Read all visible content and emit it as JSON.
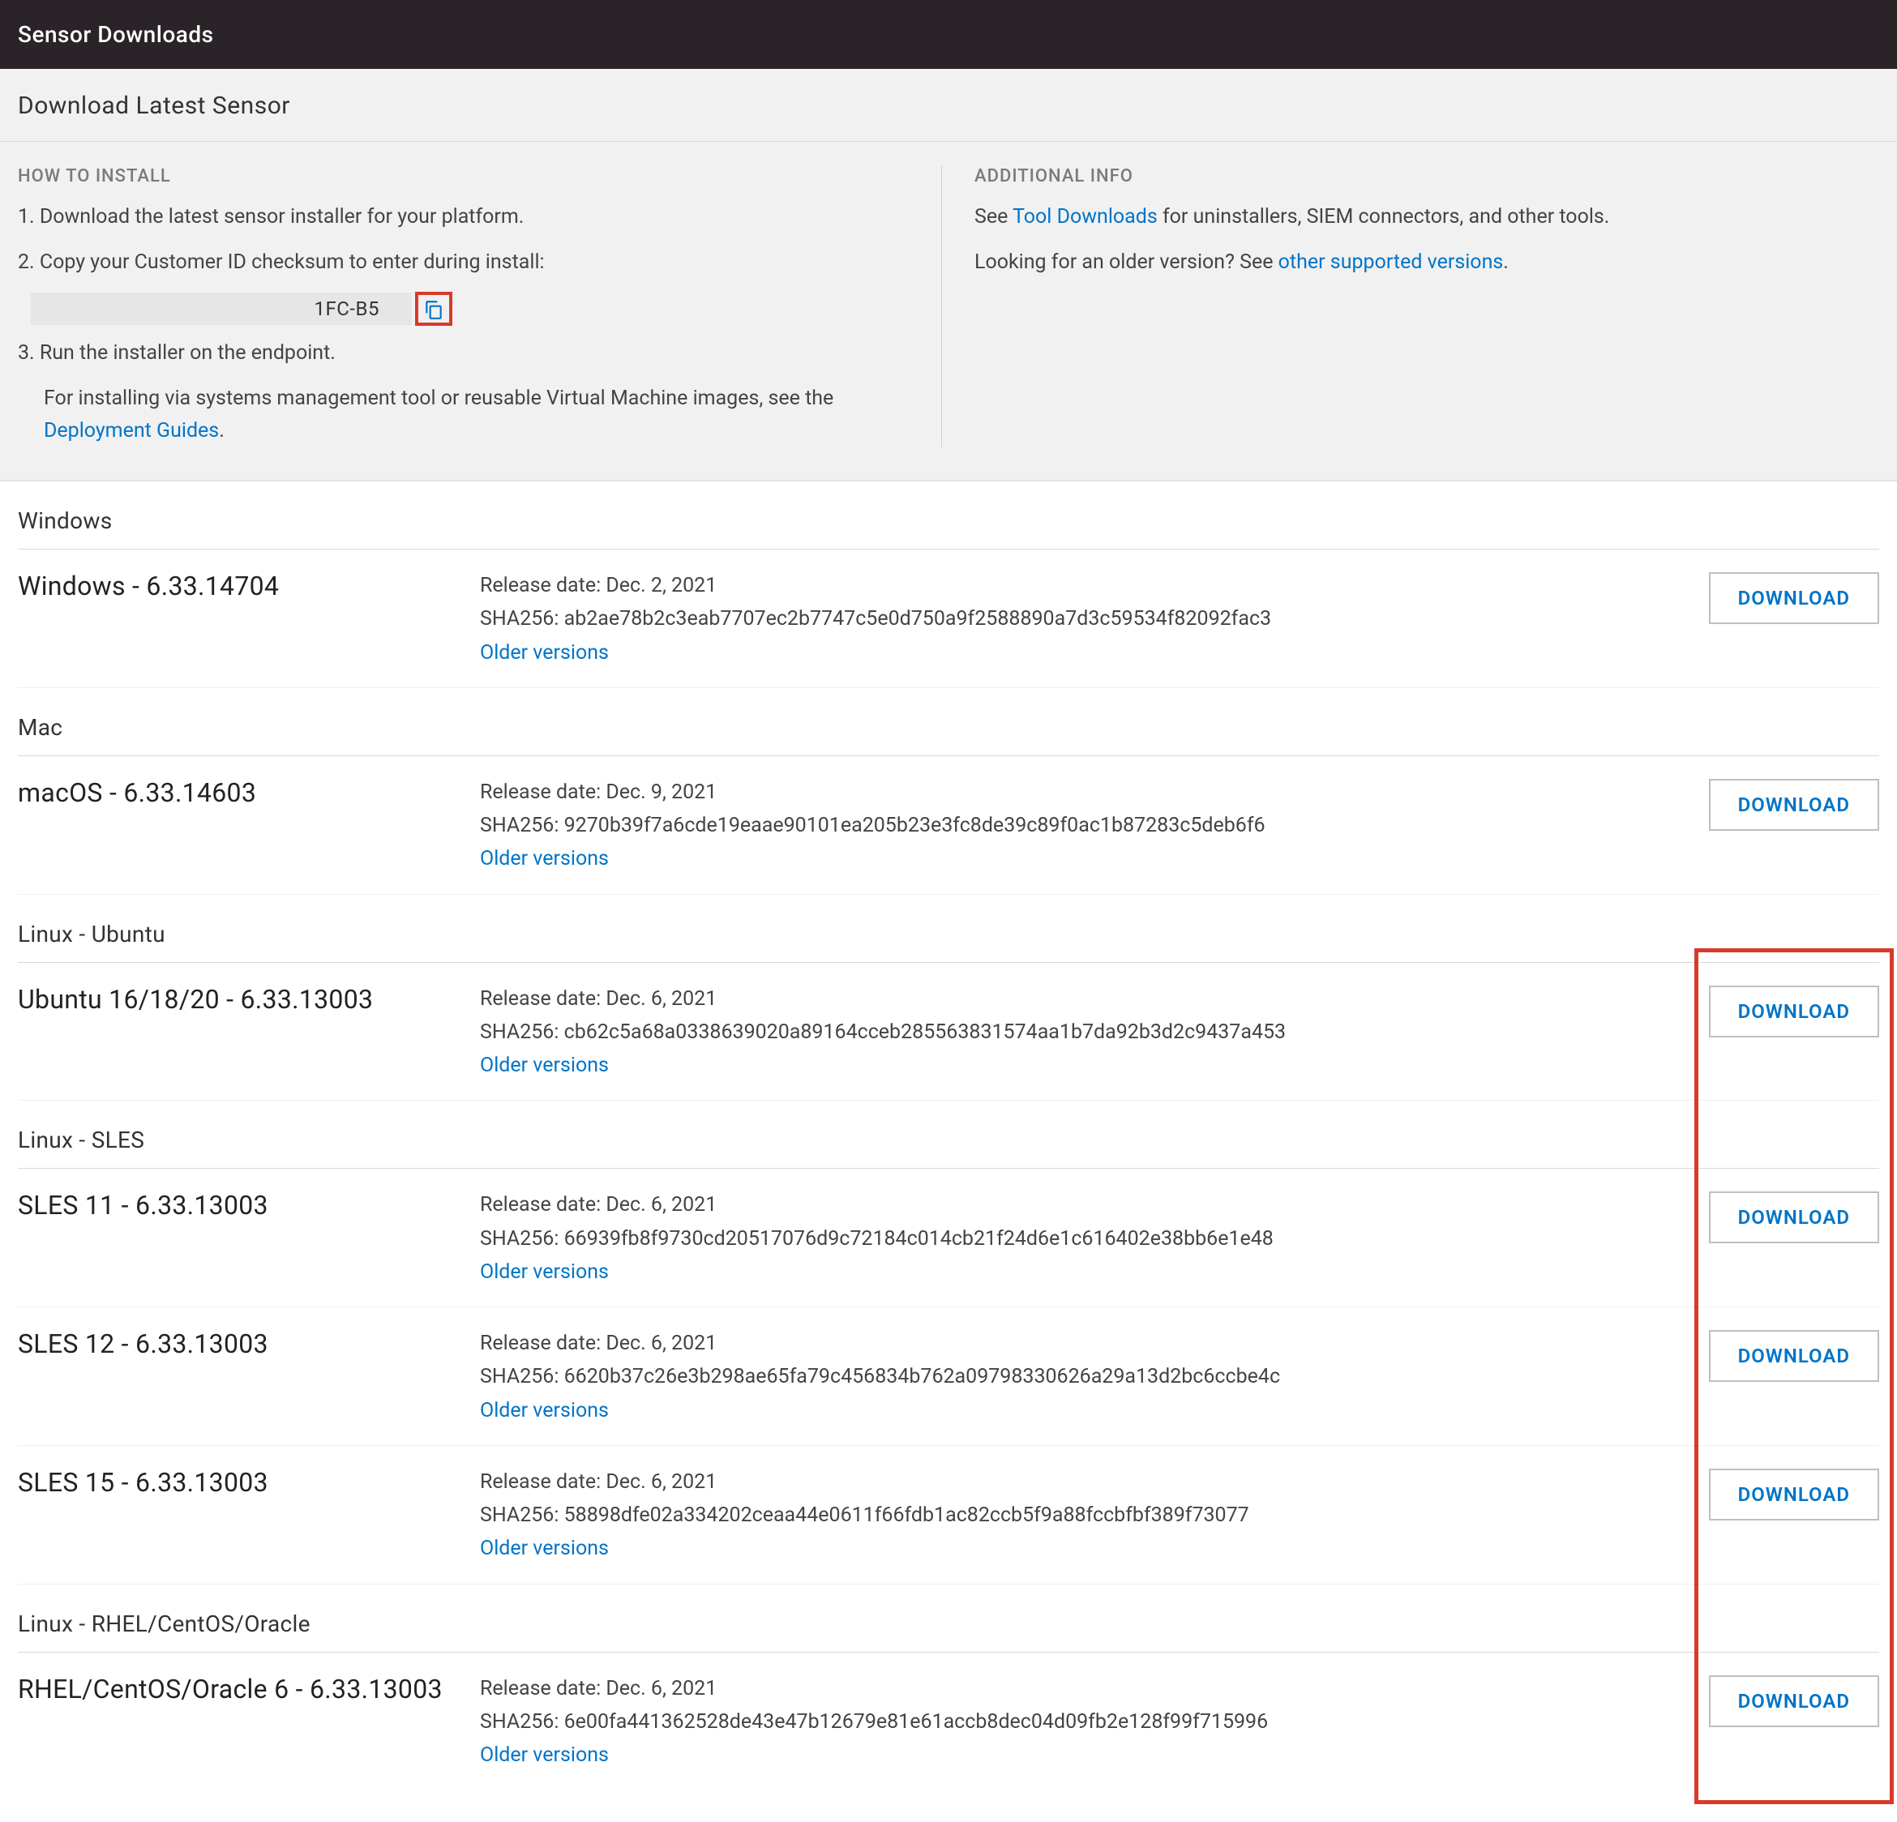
{
  "topbar": {
    "title": "Sensor Downloads"
  },
  "subheader": {
    "title": "Download Latest Sensor"
  },
  "install": {
    "kicker": "HOW TO INSTALL",
    "step1": "1. Download the latest sensor installer for your platform.",
    "step2": "2. Copy your Customer ID checksum to enter during install:",
    "cid": "1FC-B5",
    "step3": "3. Run the installer on the endpoint.",
    "step3a_pre": "For installing via systems management tool or reusable Virtual Machine images, see the ",
    "step3a_link": "Deployment Guides",
    "step3a_post": "."
  },
  "addl": {
    "kicker": "ADDITIONAL INFO",
    "line1_pre": "See ",
    "line1_link": "Tool Downloads",
    "line1_post": " for uninstallers, SIEM connectors, and other tools.",
    "line2_pre": "Looking for an older version? See ",
    "line2_link": "other supported versions",
    "line2_post": "."
  },
  "labels": {
    "download": "DOWNLOAD",
    "older": "Older versions",
    "release_prefix": "Release date: ",
    "sha_prefix": "SHA256: "
  },
  "groups": [
    {
      "platform": "Windows",
      "versions": [
        {
          "title": "Windows - 6.33.14704",
          "release": "Dec. 2, 2021",
          "sha": "ab2ae78b2c3eab7707ec2b7747c5e0d750a9f2588890a7d3c59534f82092fac3"
        }
      ]
    },
    {
      "platform": "Mac",
      "versions": [
        {
          "title": "macOS - 6.33.14603",
          "release": "Dec. 9, 2021",
          "sha": "9270b39f7a6cde19eaae90101ea205b23e3fc8de39c89f0ac1b87283c5deb6f6"
        }
      ]
    },
    {
      "platform": "Linux - Ubuntu",
      "versions": [
        {
          "title": "Ubuntu 16/18/20 - 6.33.13003",
          "release": "Dec. 6, 2021",
          "sha": "cb62c5a68a0338639020a89164cceb285563831574aa1b7da92b3d2c9437a453",
          "highlight": true
        }
      ]
    },
    {
      "platform": "Linux - SLES",
      "versions": [
        {
          "title": "SLES 11 - 6.33.13003",
          "release": "Dec. 6, 2021",
          "sha": "66939fb8f9730cd20517076d9c72184c014cb21f24d6e1c616402e38bb6e1e48",
          "highlight": true
        },
        {
          "title": "SLES 12 - 6.33.13003",
          "release": "Dec. 6, 2021",
          "sha": "6620b37c26e3b298ae65fa79c456834b762a09798330626a29a13d2bc6ccbe4c",
          "highlight": true
        },
        {
          "title": "SLES 15 - 6.33.13003",
          "release": "Dec. 6, 2021",
          "sha": "58898dfe02a334202ceaa44e0611f66fdb1ac82ccb5f9a88fccbfbf389f73077",
          "highlight": true
        }
      ]
    },
    {
      "platform": "Linux - RHEL/CentOS/Oracle",
      "versions": [
        {
          "title": "RHEL/CentOS/Oracle 6 - 6.33.13003",
          "release": "Dec. 6, 2021",
          "sha": "6e00fa441362528de43e47b12679e81e61accb8dec04d09fb2e128f99f715996",
          "highlight": true
        }
      ]
    }
  ]
}
